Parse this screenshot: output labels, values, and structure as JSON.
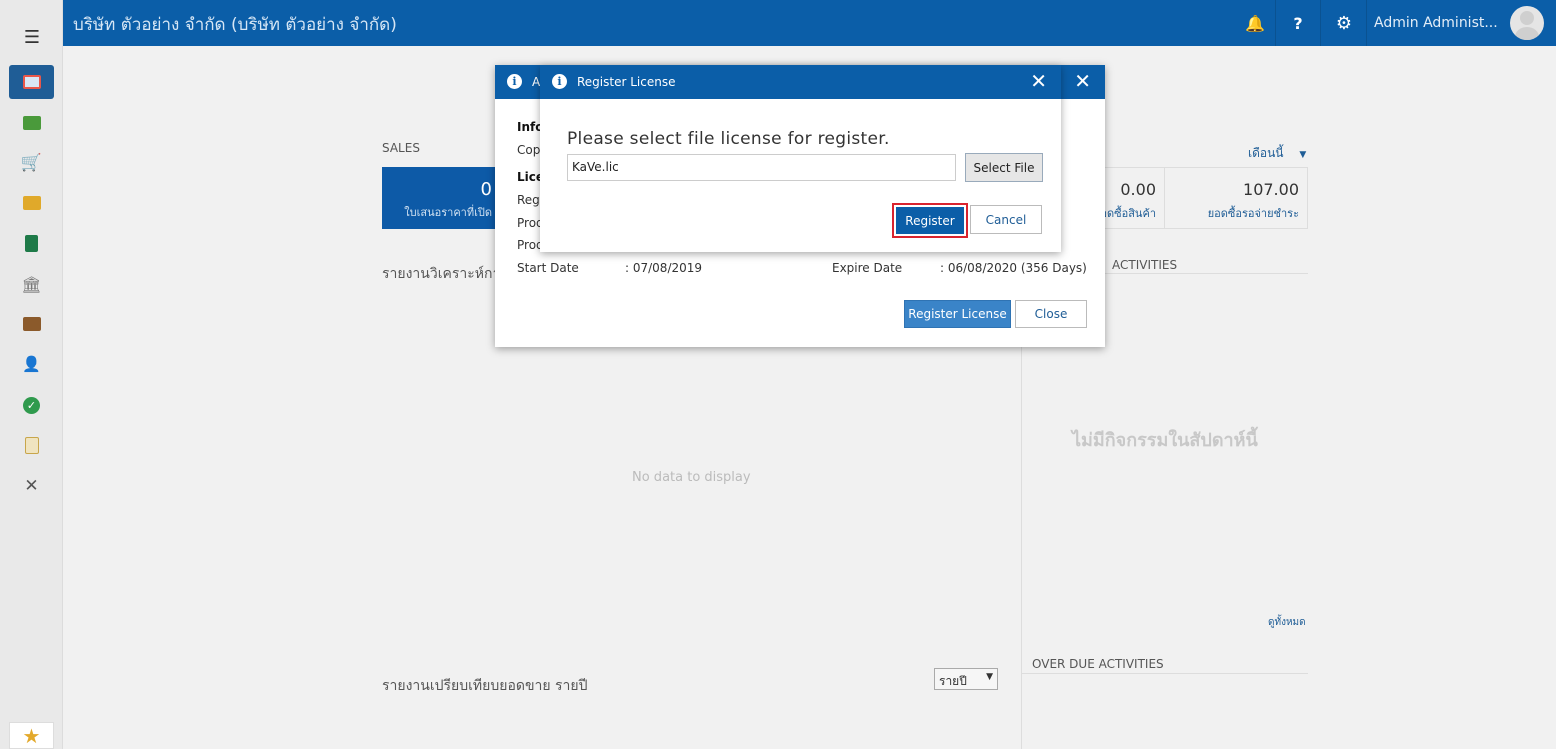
{
  "header": {
    "company": "บริษัท ตัวอย่าง จำกัด (บริษัท ตัวอย่าง จำกัด)",
    "bell_icon": "bell-icon",
    "help_label": "?",
    "settings_icon": "gear-icon",
    "user_name": "Admin Administ..."
  },
  "sidebar": {
    "items": [
      "dashboard-icon",
      "money-icon",
      "cart-icon",
      "box-icon",
      "book-icon",
      "bank-icon",
      "wallet-icon",
      "user-icon",
      "check-icon",
      "report-icon",
      "tools-icon"
    ],
    "favorite_icon": "star-icon"
  },
  "dashboard": {
    "sales_label": "SALES",
    "sales_tile_value": "0",
    "sales_tile_label": "ใบเสนอราคาที่เปิด",
    "period_label": "เดือนนี้",
    "stat1_value": "0.00",
    "stat1_label": "ยอดซื้อสินค้า",
    "stat2_value": "107.00",
    "stat2_label": "ยอดซื้อรอจ่ายชำระ",
    "analysis_label": "รายงานวิเคราะห์การขาย",
    "activities_label": "ACTIVITIES",
    "no_data": "No data to display",
    "no_activities": "ไม่มีกิจกรรมในสัปดาห์นี้",
    "view_all": "ดูทั้งหมด",
    "overdue_label": "OVER DUE ACTIVITIES",
    "yearly_label": "รายงานเปรียบเทียบยอดขาย รายปี",
    "yearly_select": "รายปี"
  },
  "about_dialog": {
    "title": "A",
    "info_heading": "Info",
    "copyright_label": "Copy",
    "license_heading": "Lice",
    "registered_label": "Regi",
    "product1_label": "Prod",
    "product2_label": "Prod",
    "start_date_label": "Start Date",
    "start_date_value": ": 07/08/2019",
    "expire_date_label": "Expire Date",
    "expire_date_value": ": 06/08/2020 (356 Days)",
    "register_license_button": "Register License",
    "close_button": "Close"
  },
  "register_dialog": {
    "title": "Register License",
    "prompt": "Please select file license for register.",
    "file_value": "KaVe.lic",
    "select_file_button": "Select File",
    "register_button": "Register",
    "cancel_button": "Cancel"
  }
}
